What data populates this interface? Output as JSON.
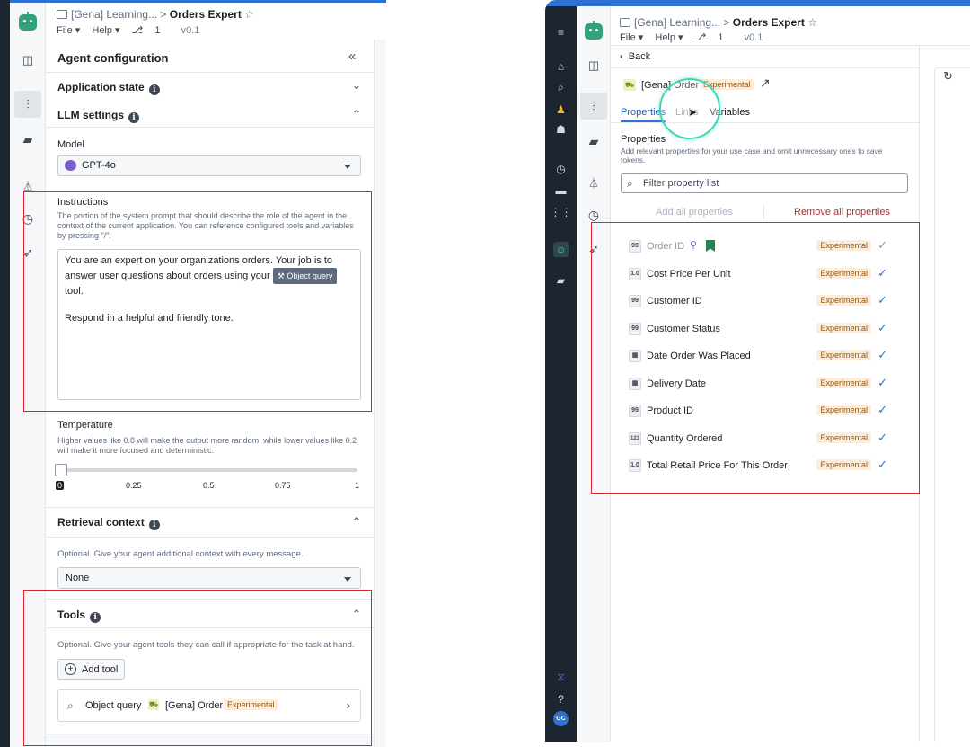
{
  "left": {
    "breadcrumb": {
      "parent": "[Gena] Learning...",
      "sep": ">",
      "current": "Orders Expert"
    },
    "menus": {
      "file": "File ▾",
      "help": "Help ▾",
      "branch": "1",
      "version": "v0.1"
    },
    "config_title": "Agent configuration",
    "collapse_glyph": "«",
    "application_state": "Application state",
    "llm_settings": "LLM settings",
    "model": {
      "label": "Model",
      "value": "GPT-4o"
    },
    "instructions": {
      "label": "Instructions",
      "hint": "The portion of the system prompt that should describe the role of the agent in the context of the current application. You can reference configured tools and variables by pressing \"/\".",
      "text_before": "You are an expert on your organizations orders. Your job is to answer user questions about orders using your",
      "chip": "Object query",
      "text_after": "tool.",
      "text_line2": "Respond in a helpful and friendly tone."
    },
    "temperature": {
      "label": "Temperature",
      "hint": "Higher values like 0.8 will make the output more random, while lower values like 0.2 will make it more focused and deterministic.",
      "value": 0,
      "ticks": [
        "0",
        "0.25",
        "0.5",
        "0.75",
        "1"
      ]
    },
    "retrieval": {
      "label": "Retrieval context",
      "hint": "Optional. Give your agent additional context with every message.",
      "value": "None"
    },
    "tools": {
      "label": "Tools",
      "hint": "Optional. Give your agent tools they can call if appropriate for the task at hand.",
      "add_button": "Add tool",
      "item": {
        "name": "Object query",
        "object": "[Gena] Order",
        "badge": "Experimental"
      }
    }
  },
  "right": {
    "breadcrumb": {
      "parent": "[Gena] Learning...",
      "sep": ">",
      "current": "Orders Expert"
    },
    "menus": {
      "file": "File ▾",
      "help": "Help ▾",
      "branch": "1",
      "version": "v0.1"
    },
    "back": "Back",
    "object": {
      "name": "[Gena] Order",
      "badge": "Experimental"
    },
    "tabs": [
      "Properties",
      "Links",
      "Variables"
    ],
    "properties_title": "Properties",
    "properties_hint": "Add relevant properties for your use case and omit unnecessary ones to save tokens.",
    "filter_placeholder": "Filter property list",
    "add_all": "Add all properties",
    "remove_all": "Remove all properties",
    "properties": [
      {
        "name": "Order ID",
        "type": "99",
        "badge": "Experimental",
        "dim": true
      },
      {
        "name": "Cost Price Per Unit",
        "type": "1.0",
        "badge": "Experimental"
      },
      {
        "name": "Customer ID",
        "type": "99",
        "badge": "Experimental"
      },
      {
        "name": "Customer Status",
        "type": "99",
        "badge": "Experimental"
      },
      {
        "name": "Date Order Was Placed",
        "type": "▦",
        "badge": "Experimental"
      },
      {
        "name": "Delivery Date",
        "type": "▦",
        "badge": "Experimental"
      },
      {
        "name": "Product ID",
        "type": "99",
        "badge": "Experimental"
      },
      {
        "name": "Quantity Ordered",
        "type": "123",
        "badge": "Experimental"
      },
      {
        "name": "Total Retail Price For This Order",
        "type": "1.0",
        "badge": "Experimental"
      }
    ],
    "avatar": "GC"
  }
}
